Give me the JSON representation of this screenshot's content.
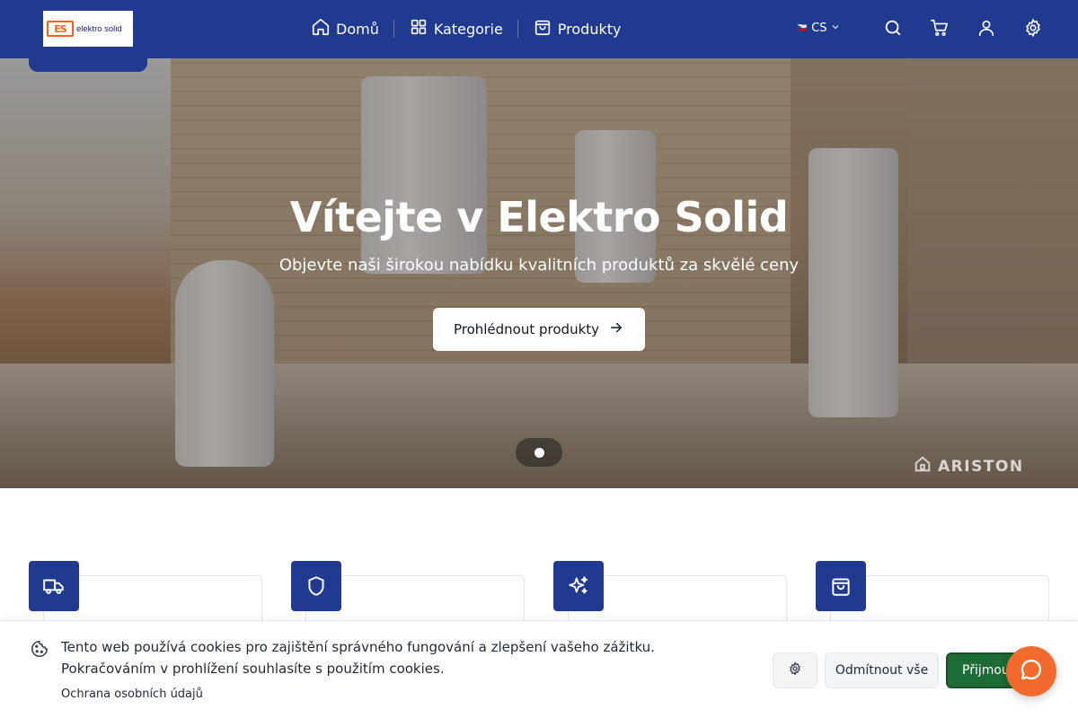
{
  "header": {
    "logo_text": "elektro solid",
    "logo_mark": "ES",
    "nav": [
      {
        "label": "Domů",
        "icon": "home-icon"
      },
      {
        "label": "Kategorie",
        "icon": "grid-icon"
      },
      {
        "label": "Produkty",
        "icon": "bag-icon"
      }
    ],
    "language": {
      "flag": "🇨🇿",
      "code": "CS"
    },
    "icons": [
      "search-icon",
      "cart-icon",
      "user-icon",
      "settings-icon"
    ],
    "color": "#1f3a8f"
  },
  "hero": {
    "title": "Vítejte v Elektro Solid",
    "subtitle": "Objevte naši širokou nabídku kvalitních produktů za skvělé ceny",
    "cta_label": "Prohlédnout produkty",
    "brand_watermark": "ARISTON",
    "slides_count": 1,
    "active_slide": 1
  },
  "features": [
    {
      "icon": "truck-icon"
    },
    {
      "icon": "shield-icon"
    },
    {
      "icon": "sparkles-icon"
    },
    {
      "icon": "shopping-bag-icon"
    }
  ],
  "cookie_bar": {
    "text": "Tento web používá cookies pro zajištění správného fungování a zlepšení vašeho zážitku. Pokračováním v prohlížení souhlasíte s použitím cookies.",
    "privacy_link": "Ochrana osobních údajů",
    "reject_label": "Odmítnout vše",
    "accept_label": "Přijmout vše",
    "accept_color": "#1d6b35"
  },
  "chat": {
    "icon": "chat-icon",
    "color": "#f26a2e"
  }
}
